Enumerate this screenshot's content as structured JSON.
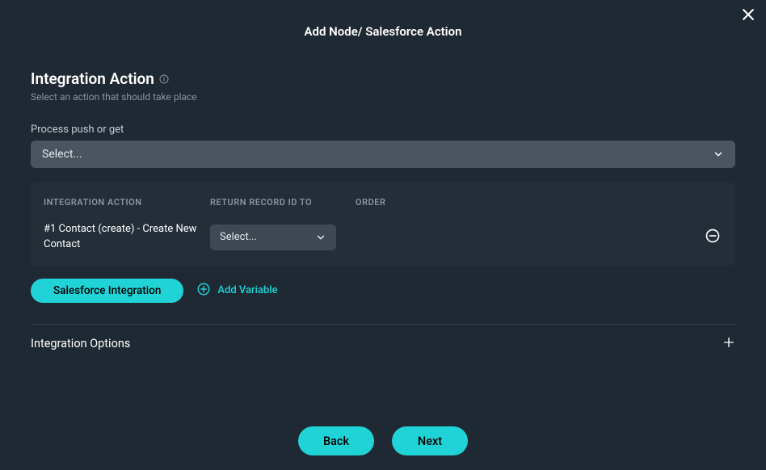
{
  "header": {
    "title": "Add Node/ Salesforce Action"
  },
  "section": {
    "title": "Integration Action",
    "subtitle": "Select an action that should take place"
  },
  "processField": {
    "label": "Process push or get",
    "placeholder": "Select..."
  },
  "table": {
    "headers": {
      "action": "INTEGRATION ACTION",
      "return": "RETURN RECORD ID TO",
      "order": "ORDER"
    },
    "rows": [
      {
        "action": "#1 Contact (create) - Create New Contact",
        "returnPlaceholder": "Select..."
      }
    ]
  },
  "buttons": {
    "salesforceIntegration": "Salesforce Integration",
    "addVariable": "Add Variable",
    "back": "Back",
    "next": "Next"
  },
  "options": {
    "title": "Integration Options"
  }
}
